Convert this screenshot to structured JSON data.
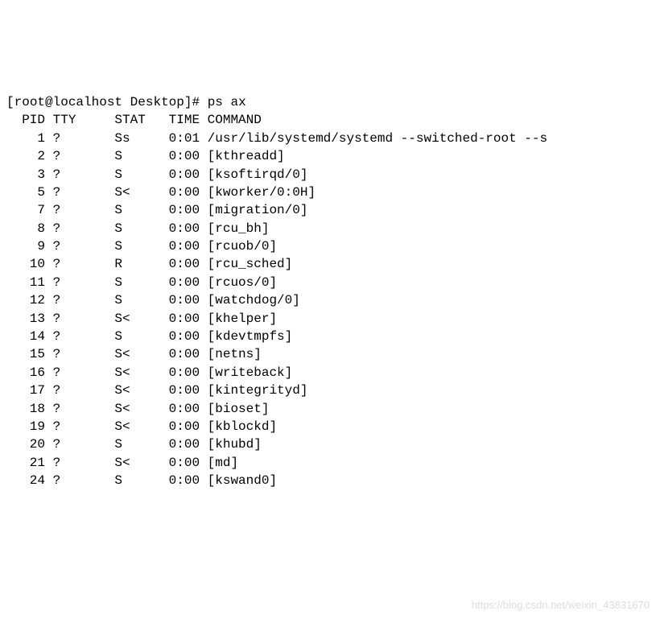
{
  "prompt": {
    "user": "root",
    "host": "localhost",
    "cwd": "Desktop",
    "symbol": "#",
    "command": "ps ax"
  },
  "header": {
    "pid": "PID",
    "tty": "TTY",
    "stat": "STAT",
    "time": "TIME",
    "command": "COMMAND"
  },
  "rows": [
    {
      "pid": "1",
      "tty": "?",
      "stat": "Ss",
      "time": "0:01",
      "command": "/usr/lib/systemd/systemd --switched-root --s"
    },
    {
      "pid": "2",
      "tty": "?",
      "stat": "S",
      "time": "0:00",
      "command": "[kthreadd]"
    },
    {
      "pid": "3",
      "tty": "?",
      "stat": "S",
      "time": "0:00",
      "command": "[ksoftirqd/0]"
    },
    {
      "pid": "5",
      "tty": "?",
      "stat": "S<",
      "time": "0:00",
      "command": "[kworker/0:0H]"
    },
    {
      "pid": "7",
      "tty": "?",
      "stat": "S",
      "time": "0:00",
      "command": "[migration/0]"
    },
    {
      "pid": "8",
      "tty": "?",
      "stat": "S",
      "time": "0:00",
      "command": "[rcu_bh]"
    },
    {
      "pid": "9",
      "tty": "?",
      "stat": "S",
      "time": "0:00",
      "command": "[rcuob/0]"
    },
    {
      "pid": "10",
      "tty": "?",
      "stat": "R",
      "time": "0:00",
      "command": "[rcu_sched]"
    },
    {
      "pid": "11",
      "tty": "?",
      "stat": "S",
      "time": "0:00",
      "command": "[rcuos/0]"
    },
    {
      "pid": "12",
      "tty": "?",
      "stat": "S",
      "time": "0:00",
      "command": "[watchdog/0]"
    },
    {
      "pid": "13",
      "tty": "?",
      "stat": "S<",
      "time": "0:00",
      "command": "[khelper]"
    },
    {
      "pid": "14",
      "tty": "?",
      "stat": "S",
      "time": "0:00",
      "command": "[kdevtmpfs]"
    },
    {
      "pid": "15",
      "tty": "?",
      "stat": "S<",
      "time": "0:00",
      "command": "[netns]"
    },
    {
      "pid": "16",
      "tty": "?",
      "stat": "S<",
      "time": "0:00",
      "command": "[writeback]"
    },
    {
      "pid": "17",
      "tty": "?",
      "stat": "S<",
      "time": "0:00",
      "command": "[kintegrityd]"
    },
    {
      "pid": "18",
      "tty": "?",
      "stat": "S<",
      "time": "0:00",
      "command": "[bioset]"
    },
    {
      "pid": "19",
      "tty": "?",
      "stat": "S<",
      "time": "0:00",
      "command": "[kblockd]"
    },
    {
      "pid": "20",
      "tty": "?",
      "stat": "S",
      "time": "0:00",
      "command": "[khubd]"
    },
    {
      "pid": "21",
      "tty": "?",
      "stat": "S<",
      "time": "0:00",
      "command": "[md]"
    },
    {
      "pid": "24",
      "tty": "?",
      "stat": "S",
      "time": "0:00",
      "command": "[kswand0]"
    }
  ],
  "watermark": "https://blog.csdn.net/weixin_43831670"
}
